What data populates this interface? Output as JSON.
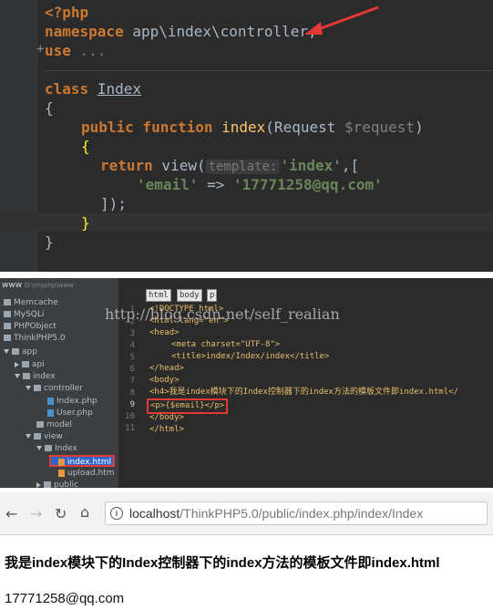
{
  "code_panel": {
    "lines": {
      "l1": "<?php",
      "l2_kw": "namespace",
      "l2_rest": " app\\index\\controller;",
      "l3_kw": "use",
      "l3_rest": " ...",
      "l4_kw": "class",
      "l4_name": "Index",
      "l5": "{",
      "l6_kw": "public function",
      "l6_fn": " index",
      "l6_args_open": "(Request ",
      "l6_param": "$request",
      "l6_args_close": ")",
      "l7": "{",
      "l8_kw": "return",
      "l8_fn": " view(",
      "l8_hint": "template:",
      "l8_str": "'index'",
      "l8_rest": ",[",
      "l9_key": "'email'",
      "l9_arrow": " => ",
      "l9_val": "'17771258@qq.com'",
      "l10": "]);",
      "l11": "}",
      "l12": "}"
    },
    "arrow_color": "#e53935"
  },
  "project_tree": {
    "root": "www",
    "root_path": "D:\\myphp\\www",
    "items": [
      "Memcache",
      "MySQLi",
      "PHPObject",
      "ThinkPHP5.0",
      "app",
      "api",
      "index",
      "controller",
      "Index.php",
      "User.php",
      "model",
      "view",
      "Index",
      "index.html",
      "upload.htm",
      "public"
    ]
  },
  "html_editor": {
    "breadcrumbs": [
      "html",
      "body",
      "p"
    ],
    "line_numbers": [
      "1",
      "2",
      "3",
      "4",
      "5",
      "6",
      "7",
      "8",
      "9",
      "10",
      "11"
    ],
    "doctype": "<!DOCTYPE html>",
    "html_open": "<html lang=\"en\">",
    "head_open": "<head>",
    "meta": "<meta charset=\"UTF-8\">",
    "title_line": "<title>index/Index/index</title>",
    "head_close": "</head>",
    "body_open": "<body>",
    "h4_line": "<h4>我是index模块下的Index控制器下的index方法的模板文件即index.html</",
    "p_line": "<p>{$email}</p>",
    "body_close": "</body>",
    "html_close": "</html>",
    "watermark": "http://blog.csdn.net/self_realian",
    "highlight_color": "#e53935"
  },
  "browser": {
    "url_host": "localhost",
    "url_path": "/ThinkPHP5.0/public/index.php/index/Index",
    "heading": "我是index模块下的Index控制器下的index方法的模板文件即index.html",
    "email": "17771258@qq.com"
  }
}
